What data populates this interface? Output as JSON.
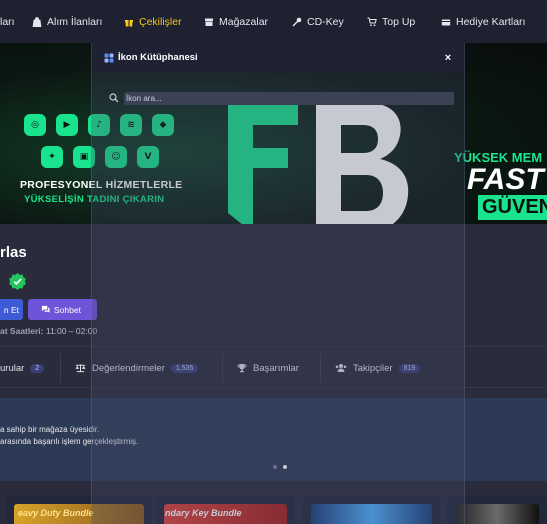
{
  "nav": {
    "items": [
      {
        "label": "ları",
        "icon": "partial-icon"
      },
      {
        "label": "Alım İlanları",
        "icon": "bag-icon"
      },
      {
        "label": "Çekilişler",
        "icon": "gift-icon"
      },
      {
        "label": "Mağazalar",
        "icon": "store-icon"
      },
      {
        "label": "CD-Key",
        "icon": "key-icon"
      },
      {
        "label": "Top Up",
        "icon": "cart-icon"
      },
      {
        "label": "Hediye Kartları",
        "icon": "gift-card-icon"
      }
    ],
    "active_color": "#f5c518"
  },
  "banner": {
    "headline": "PROFESYONEL HİZMETLERLE",
    "subline": "YÜKSELİŞİN TADINI ÇIKARIN",
    "logo_text": "FB",
    "right_line1": "YÜKSEK MEM",
    "right_line2": "FAST",
    "right_line3": "GÜVEN",
    "accent": "#19e38c"
  },
  "modal": {
    "title": "İkon Kütüphanesi",
    "close_label": "×",
    "search_placeholder": "İkon ara..."
  },
  "store": {
    "title_partial": "rlas",
    "follow_label": "n Et",
    "chat_label": "Sohbet",
    "hours_label": "at Saatleri:",
    "hours_value": "11:00 – 02:00"
  },
  "tabs": [
    {
      "label": "urular",
      "count": "2",
      "icon": "box-icon"
    },
    {
      "label": "Değerlendirmeler",
      "count": "1,535",
      "icon": "scale-icon"
    },
    {
      "label": "Başarımlar",
      "count": "",
      "icon": "trophy-icon"
    },
    {
      "label": "Takipçiler",
      "count": "819",
      "icon": "users-icon"
    }
  ],
  "about": {
    "line1": "a sahip bir mağaza üyesidir.",
    "line2": "arasında başarılı işlem gerçekleştirmiş."
  },
  "cards": [
    {
      "label": "eavy Duty Bundle",
      "color": "#e0b12b"
    },
    {
      "label": "ndary Key Bundle",
      "color": "#d93a2f"
    },
    {
      "label": "",
      "color": "#2f79c4"
    },
    {
      "label": "",
      "color": "#3a3a3a"
    }
  ]
}
